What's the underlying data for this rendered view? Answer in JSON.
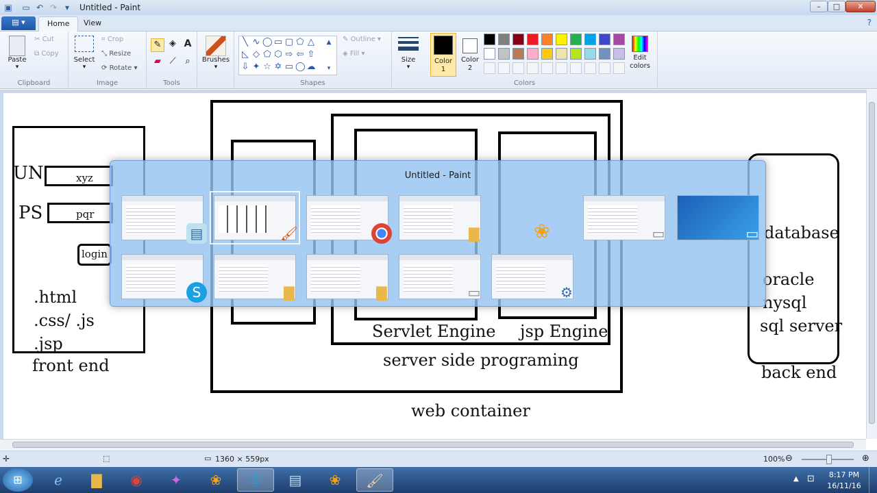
{
  "window": {
    "title": "Untitled - Paint"
  },
  "tabs": {
    "file": "▤ ▾",
    "home": "Home",
    "view": "View"
  },
  "ribbon": {
    "clipboard": {
      "label": "Clipboard",
      "paste": "Paste",
      "cut": "Cut",
      "copy": "Copy"
    },
    "image": {
      "label": "Image",
      "select": "Select",
      "crop": "Crop",
      "resize": "Resize",
      "rotate": "Rotate ▾"
    },
    "tools": {
      "label": "Tools"
    },
    "brushes": {
      "label": "Brushes"
    },
    "shapes": {
      "label": "Shapes",
      "outline": "Outline ▾",
      "fill": "Fill ▾"
    },
    "size": {
      "label": "Size"
    },
    "color1": {
      "label": "Color 1"
    },
    "color2": {
      "label": "Color 2"
    },
    "colors": {
      "label": "Colors",
      "edit": "Edit colors"
    },
    "palette_row1": [
      "#000000",
      "#7f7f7f",
      "#880015",
      "#ed1c24",
      "#ff7f27",
      "#fff200",
      "#22b14c",
      "#00a2e8",
      "#3f48cc",
      "#a349a4"
    ],
    "palette_row2": [
      "#ffffff",
      "#c3c3c3",
      "#b97a57",
      "#ffaec9",
      "#ffc90e",
      "#efe4b0",
      "#b5e61d",
      "#99d9ea",
      "#7092be",
      "#c8bfe7"
    ]
  },
  "canvas": {
    "un": "UN",
    "un_value": "xyz",
    "ps": "PS",
    "ps_value": "pqr",
    "login": "login",
    "html": ".html",
    "cssjs": ".css/ .js",
    "jsp": ".jsp",
    "front_end": "front end",
    "servlet_engine": "Servlet Engine",
    "jsp_engine": "jsp Engine",
    "server_side": "server side programing",
    "web_container": "web container",
    "database": "database",
    "oracle": "oracle",
    "mysql": "nysql",
    "sqlserver": "sql server",
    "back_end": "back end"
  },
  "switcher": {
    "title": "Untitled - Paint"
  },
  "status": {
    "dimensions": "1360 × 559px",
    "zoom": "100%"
  },
  "clock": {
    "time": "8:17 PM",
    "date": "16/11/16"
  }
}
